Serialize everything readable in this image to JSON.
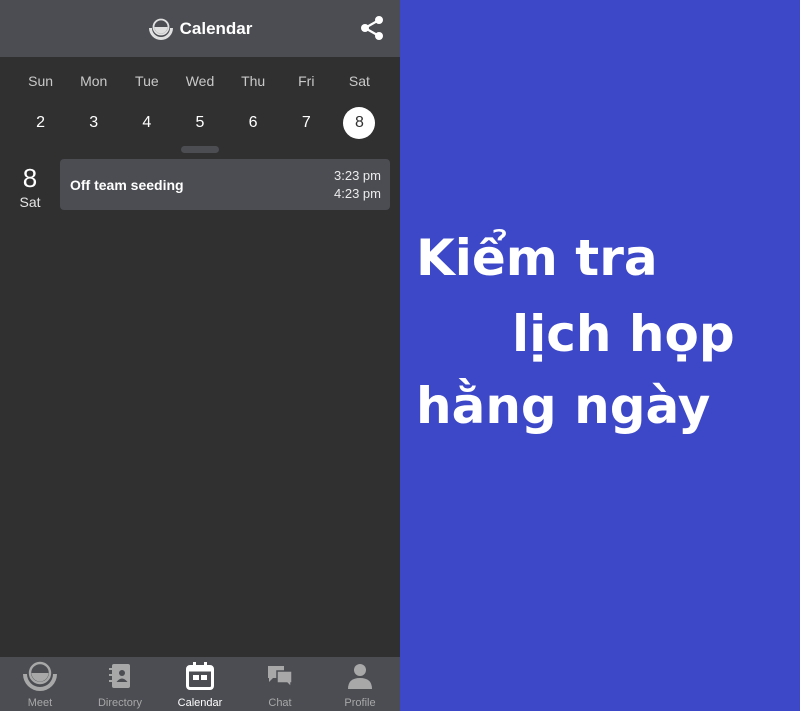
{
  "header": {
    "title": "Calendar",
    "logo_icon": "meet-logo-icon",
    "share_icon": "share-icon"
  },
  "calendar": {
    "weekdays": [
      "Sun",
      "Mon",
      "Tue",
      "Wed",
      "Thu",
      "Fri",
      "Sat"
    ],
    "dates": [
      "2",
      "3",
      "4",
      "5",
      "6",
      "7",
      "8"
    ],
    "selected_date": "8"
  },
  "agenda": {
    "day_number": "8",
    "day_name": "Sat",
    "events": [
      {
        "title": "Off team seeding",
        "start": "3:23 pm",
        "end": "4:23 pm"
      }
    ]
  },
  "bottom_nav": {
    "items": [
      {
        "label": "Meet",
        "icon": "meet-icon"
      },
      {
        "label": "Directory",
        "icon": "directory-icon"
      },
      {
        "label": "Calendar",
        "icon": "calendar-icon",
        "active": true
      },
      {
        "label": "Chat",
        "icon": "chat-icon"
      },
      {
        "label": "Profile",
        "icon": "profile-icon"
      }
    ]
  },
  "promo": {
    "line1": "Kiểm tra",
    "line2": "lịch họp",
    "line3": "hằng ngày"
  },
  "colors": {
    "header_bg": "#4b4d52",
    "app_bg": "#303030",
    "promo_bg": "#3d48c9",
    "text": "#ffffff"
  }
}
